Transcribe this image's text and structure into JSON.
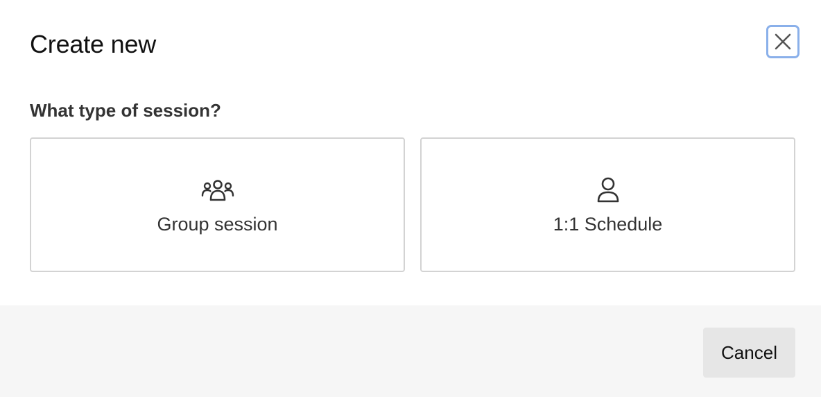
{
  "dialog": {
    "title": "Create new",
    "close_icon": "close-icon"
  },
  "session": {
    "question": "What type of session?",
    "options": [
      {
        "label": "Group session",
        "icon": "group-icon"
      },
      {
        "label": "1:1 Schedule",
        "icon": "person-icon"
      }
    ]
  },
  "footer": {
    "cancel_label": "Cancel"
  },
  "colors": {
    "focus_ring": "#8ab0ea",
    "border": "#d3d3d3",
    "footer_bg": "#f6f6f6",
    "cancel_bg": "#e6e6e6",
    "text": "#333333"
  }
}
